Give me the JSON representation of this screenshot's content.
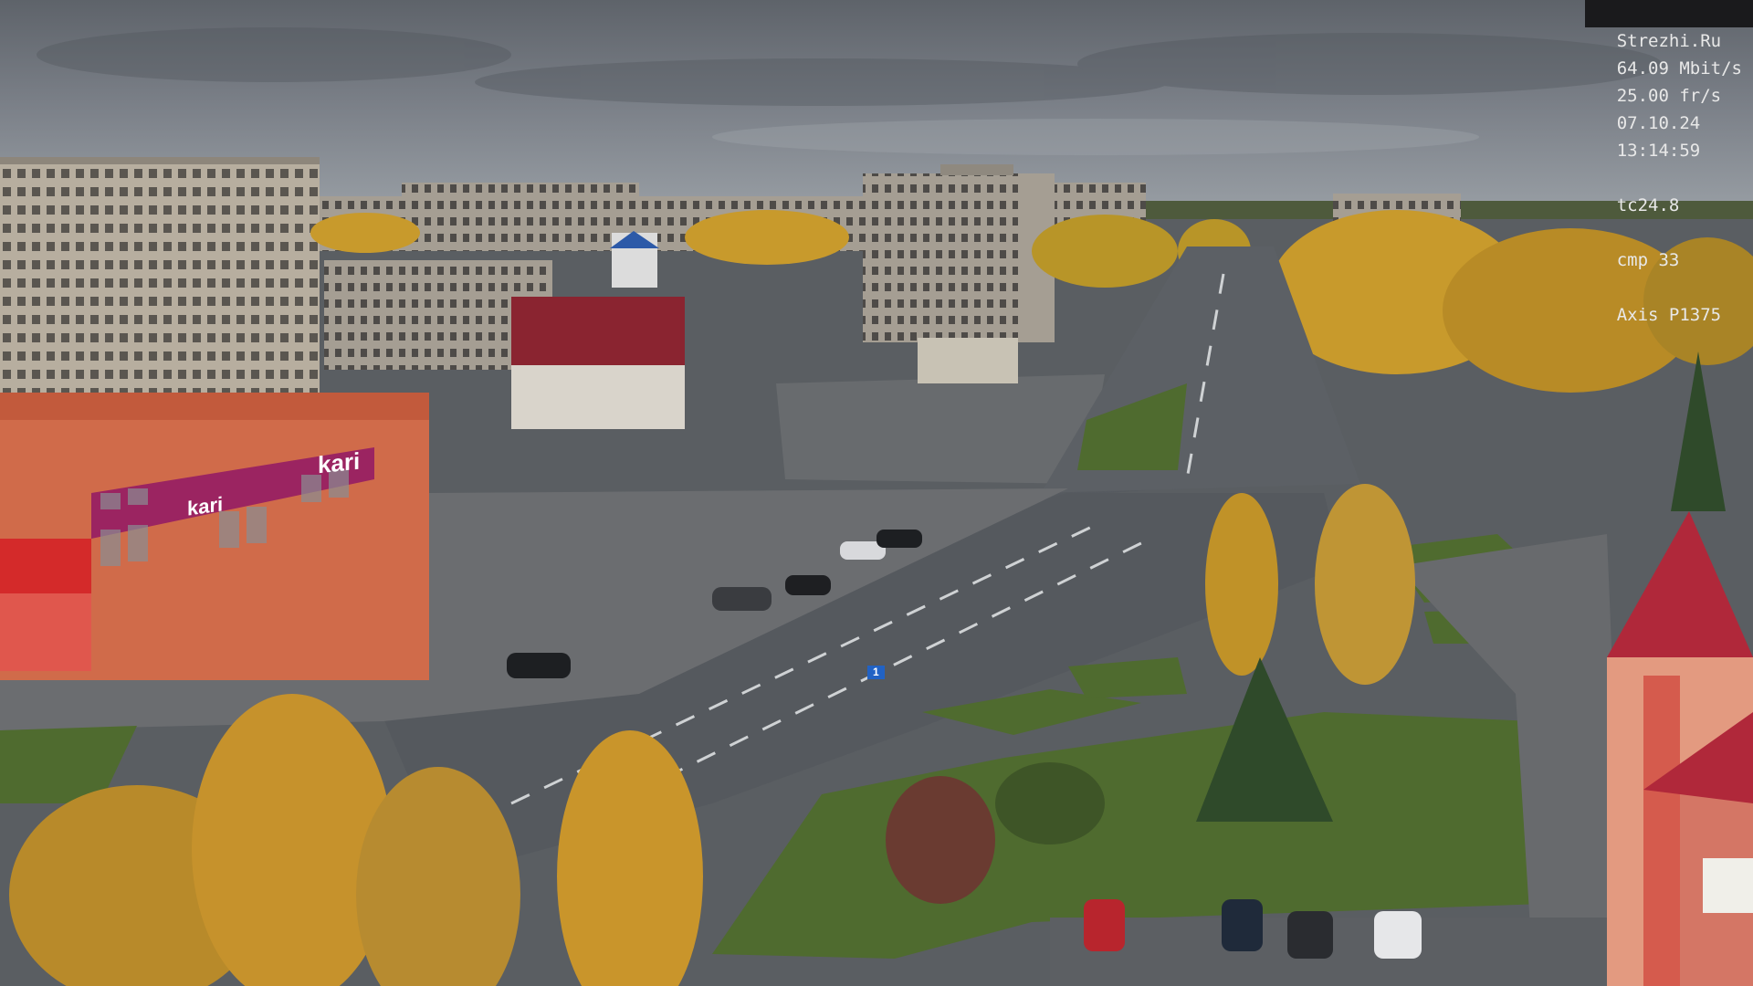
{
  "overlay": {
    "site": "Strezhi.Ru",
    "bitrate": "64.09 Mbit/s",
    "framerate": "25.00 fr/s",
    "date": "07.10.24",
    "time": "13:14:59",
    "tc": "tc24.8",
    "cmp": "cmp 33",
    "camera": "Axis P1375"
  },
  "signs": {
    "store_logo": "kari",
    "store_logo_small": "kari",
    "road_sign_blue": "1"
  },
  "colors": {
    "sky": "#7a7f86",
    "asphalt": "#55595e",
    "grass": "#4f6b2f",
    "autumn_birch": "#c89a2c",
    "store_magenta": "#9b2461",
    "store_orange": "#d06b4a",
    "building_red_roof": "#b0283a"
  }
}
